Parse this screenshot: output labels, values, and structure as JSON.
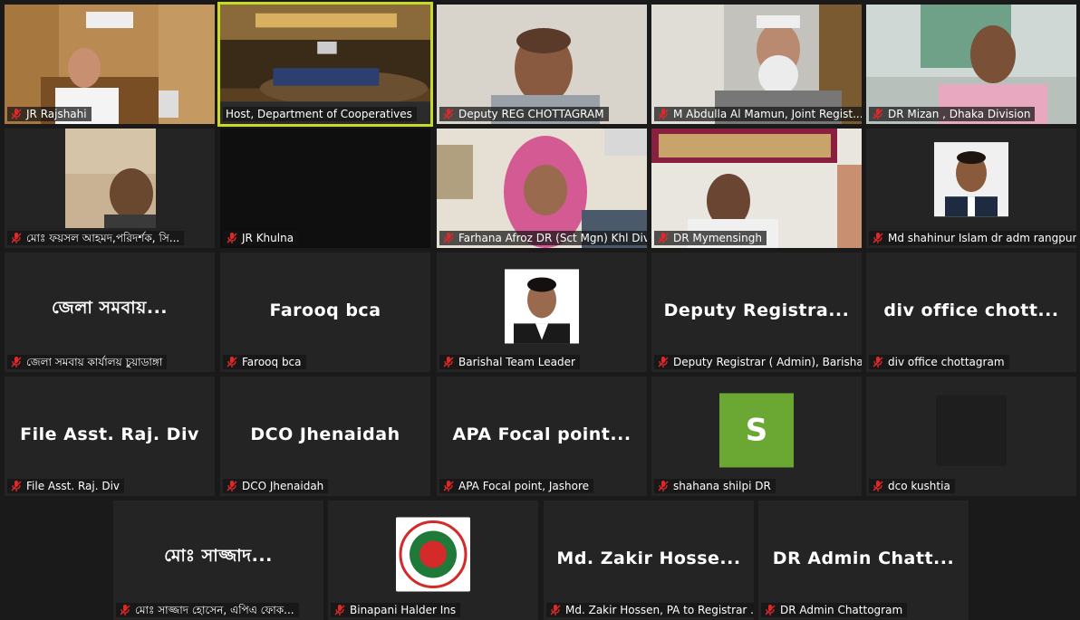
{
  "meeting": {
    "participants": [
      {
        "label": "JR Rajshahi",
        "muted": true
      },
      {
        "label": "Host, Department of Cooperatives",
        "muted": false,
        "active": true
      },
      {
        "label": "Deputy REG CHOTTAGRAM",
        "muted": true
      },
      {
        "label": "M Abdulla Al Mamun, Joint Regist...",
        "muted": true
      },
      {
        "label": "DR Mizan , Dhaka Division",
        "muted": true
      },
      {
        "label": "মোঃ ফয়সল আহমদ,পরিদর্শক, সি...",
        "muted": true
      },
      {
        "label": "JR Khulna",
        "muted": true
      },
      {
        "label": "Farhana Afroz DR (Sct Mgn) Khl Div",
        "muted": true
      },
      {
        "label": "DR Mymensingh",
        "muted": true
      },
      {
        "label": "Md shahinur Islam dr adm rangpur",
        "muted": true
      },
      {
        "label": "জেলা সমবায় কার্যালয় চুয়াডাঙ্গা",
        "display_name": "জেলা সমবায়...",
        "muted": true
      },
      {
        "label": "Farooq bca",
        "display_name": "Farooq bca",
        "muted": true
      },
      {
        "label": "Barishal Team Leader",
        "muted": true
      },
      {
        "label": "Deputy Registrar ( Admin), Barishal",
        "display_name": "Deputy Registra...",
        "muted": true
      },
      {
        "label": "div office chottagram",
        "display_name": "div office chott...",
        "muted": true
      },
      {
        "label": "File Asst. Raj. Div",
        "display_name": "File Asst. Raj. Div",
        "muted": true
      },
      {
        "label": "DCO Jhenaidah",
        "display_name": "DCO Jhenaidah",
        "muted": true
      },
      {
        "label": "APA Focal point, Jashore",
        "display_name": "APA Focal point...",
        "muted": true
      },
      {
        "label": "shahana shilpi DR",
        "avatar_letter": "S",
        "muted": true
      },
      {
        "label": "dco kushtia",
        "muted": true
      },
      {
        "label": "মোঃ সাজ্জাদ হোসেন, এপিএ ফোক...",
        "display_name": "মোঃ সাজ্জাদ...",
        "muted": true
      },
      {
        "label": "Binapani Halder Ins",
        "muted": true
      },
      {
        "label": "Md. Zakir Hossen, PA to Registrar ...",
        "display_name": "Md. Zakir Hosse...",
        "muted": true
      },
      {
        "label": "DR Admin Chattogram",
        "display_name": "DR Admin Chatt...",
        "muted": true
      }
    ]
  },
  "colors": {
    "background": "#1a1a1a",
    "tile": "#242424",
    "active_border": "#c7d92a",
    "muted_icon": "#e02828",
    "avatar_green": "#6aa833"
  },
  "icons": {
    "muted": "microphone-muted-icon"
  }
}
